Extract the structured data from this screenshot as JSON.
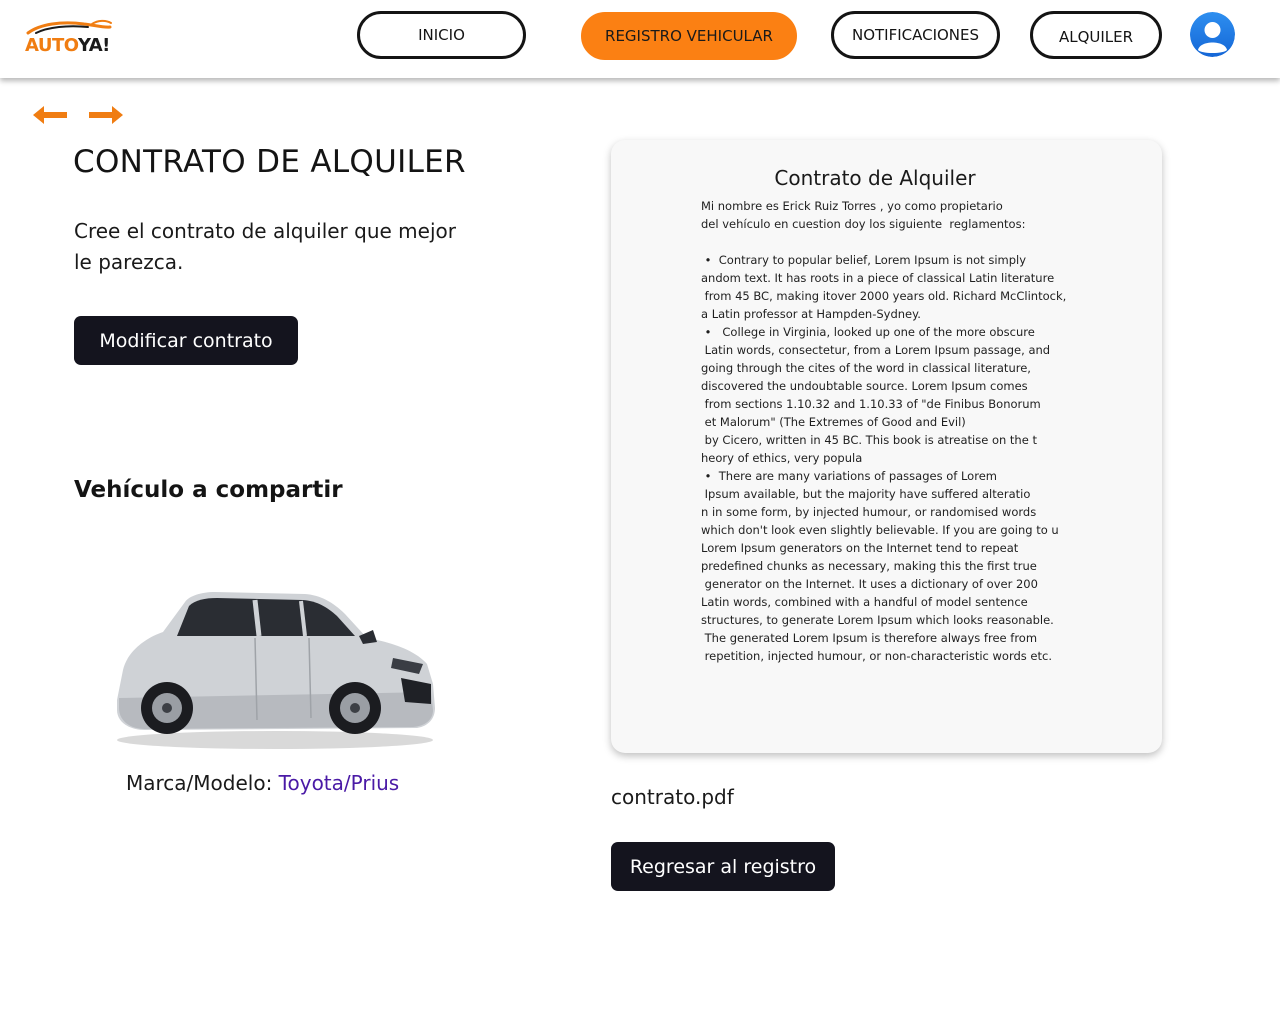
{
  "header": {
    "logo": {
      "part1": "AUTO",
      "part2": "YA!"
    },
    "nav": {
      "inicio": "INICIO",
      "registro": "REGISTRO VEHICULAR",
      "notificaciones": "NOTIFICACIONES",
      "alquiler": "ALQUILER"
    },
    "accent_color": "#fb8013"
  },
  "navigation": {
    "back_icon": "arrow-left-icon",
    "forward_icon": "arrow-right-icon"
  },
  "main": {
    "title": "CONTRATO DE ALQUILER",
    "subtitle": "Cree el contrato de alquiler que mejor le parezca.",
    "modify_button": "Modificar contrato",
    "vehicle_section_title": "Vehículo a compartir",
    "vehicle": {
      "label": "Marca/Modelo:",
      "model": "Toyota/Prius"
    }
  },
  "contract": {
    "title": "Contrato de Alquiler",
    "lines": [
      "Mi nombre es Erick Ruiz Torres , yo como propietario",
      "del vehículo en cuestion doy los siguiente  reglamentos:",
      "",
      " •  Contrary to popular belief, Lorem Ipsum is not simply",
      "andom text. It has roots in a piece of classical Latin literature",
      " from 45 BC, making itover 2000 years old. Richard McClintock,",
      "a Latin professor at Hampden-Sydney.",
      " •   College in Virginia, looked up one of the more obscure",
      " Latin words, consectetur, from a Lorem Ipsum passage, and",
      "going through the cites of the word in classical literature,",
      "discovered the undoubtable source. Lorem Ipsum comes",
      " from sections 1.10.32 and 1.10.33 of \"de Finibus Bonorum",
      " et Malorum\" (The Extremes of Good and Evil)",
      " by Cicero, written in 45 BC. This book is atreatise on the t",
      "heory of ethics, very popula",
      " •  There are many variations of passages of Lorem",
      " Ipsum available, but the majority have suffered alteratio",
      "n in some form, by injected humour, or randomised words",
      "which don't look even slightly believable. If you are going to u",
      "Lorem Ipsum generators on the Internet tend to repeat",
      "predefined chunks as necessary, making this the first true",
      " generator on the Internet. It uses a dictionary of over 200",
      "Latin words, combined with a handful of model sentence",
      "structures, to generate Lorem Ipsum which looks reasonable.",
      " The generated Lorem Ipsum is therefore always free from",
      " repetition, injected humour, or non-characteristic words etc."
    ],
    "filename": "contrato.pdf",
    "back_button": "Regresar al registro"
  }
}
